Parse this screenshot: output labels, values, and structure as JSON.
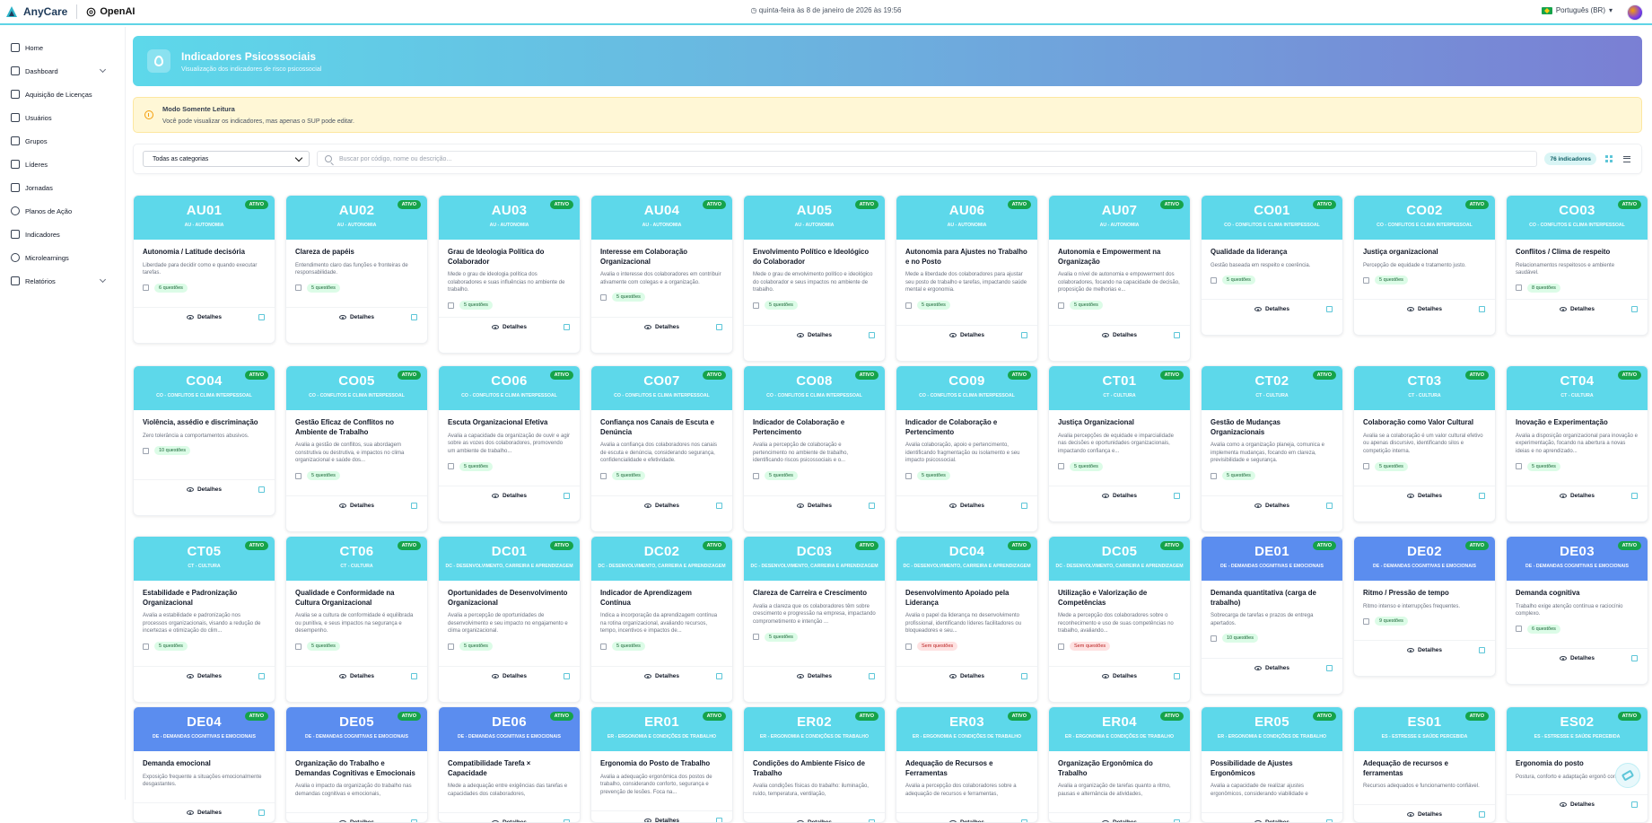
{
  "header": {
    "brand": "AnyCare",
    "partner": "OpenAI",
    "datetime": "quinta-feira às 8 de janeiro de 2026 às 19:56",
    "language": "Português (BR)"
  },
  "sidebar": {
    "items": [
      {
        "label": "Home",
        "icon": "home-icon"
      },
      {
        "label": "Dashboard",
        "icon": "dashboard-icon",
        "expandable": true
      },
      {
        "label": "Aquisição de Licenças",
        "icon": "license-icon"
      },
      {
        "label": "Usuários",
        "icon": "users-icon"
      },
      {
        "label": "Grupos",
        "icon": "folder-icon"
      },
      {
        "label": "Líderes",
        "icon": "leaders-icon"
      },
      {
        "label": "Jornadas",
        "icon": "journey-icon"
      },
      {
        "label": "Planos de Ação",
        "icon": "check-circle-icon"
      },
      {
        "label": "Indicadores",
        "icon": "indicators-icon"
      },
      {
        "label": "Microlearnings",
        "icon": "play-icon"
      },
      {
        "label": "Relatórios",
        "icon": "reports-icon",
        "expandable": true
      }
    ]
  },
  "hero": {
    "title": "Indicadores Psicossociais",
    "subtitle": "Visualização dos indicadores de risco psicossocial"
  },
  "notice": {
    "title": "Modo Somente Leitura",
    "text": "Você pode visualizar os indicadores, mas apenas o SUP pode editar."
  },
  "filters": {
    "category": "Todas as categorias",
    "search_placeholder": "Buscar por código, nome ou descrição...",
    "count": "76 indicadores"
  },
  "colors": {
    "cyan": "#5dd8ea",
    "blue": "#5b8def",
    "green": "#16a34a"
  },
  "card_labels": {
    "status": "ATIVO",
    "details": "Detalhes"
  },
  "cards": [
    {
      "code": "AU01",
      "cat": "AU - AUTONOMIA",
      "title": "Autonomia / Latitude decisória",
      "desc": "Liberdade para decidir como e quando executar tarefas.",
      "q": "6 questões"
    },
    {
      "code": "AU02",
      "cat": "AU - AUTONOMIA",
      "title": "Clareza de papéis",
      "desc": "Entendimento claro das funções e fronteiras de responsabilidade.",
      "q": "5 questões"
    },
    {
      "code": "AU03",
      "cat": "AU - AUTONOMIA",
      "title": "Grau de Ideologia Política do Colaborador",
      "desc": "Mede o grau de ideologia política dos colaboradores e suas influências no ambiente de trabalho.",
      "q": "5 questões"
    },
    {
      "code": "AU04",
      "cat": "AU - AUTONOMIA",
      "title": "Interesse em Colaboração Organizacional",
      "desc": "Avalia o interesse dos colaboradores em contribuir ativamente com colegas e a organização.",
      "q": "5 questões"
    },
    {
      "code": "AU05",
      "cat": "AU - AUTONOMIA",
      "title": "Envolvimento Político e Ideológico do Colaborador",
      "desc": "Mede o grau de envolvimento político e ideológico do colaborador e seus impactos no ambiente de trabalho.",
      "q": "5 questões"
    },
    {
      "code": "AU06",
      "cat": "AU - AUTONOMIA",
      "title": "Autonomia para Ajustes no Trabalho e no Posto",
      "desc": "Mede a liberdade dos colaboradores para ajustar seu posto de trabalho e tarefas, impactando saúde mental e ergonomia.",
      "q": "5 questões"
    },
    {
      "code": "AU07",
      "cat": "AU - AUTONOMIA",
      "title": "Autonomia e Empowerment na Organização",
      "desc": "Avalia o nível de autonomia e empowerment dos colaboradores, focando na capacidade de decisão, proposição de melhorias e...",
      "q": "5 questões"
    },
    {
      "code": "CO01",
      "cat": "CO - CONFLITOS E CLIMA INTERPESSOAL",
      "title": "Qualidade da liderança",
      "desc": "Gestão baseada em respeito e coerência.",
      "q": "5 questões"
    },
    {
      "code": "CO02",
      "cat": "CO - CONFLITOS E CLIMA INTERPESSOAL",
      "title": "Justiça organizacional",
      "desc": "Percepção de equidade e tratamento justo.",
      "q": "5 questões"
    },
    {
      "code": "CO03",
      "cat": "CO - CONFLITOS E CLIMA INTERPESSOAL",
      "title": "Conflitos / Clima de respeito",
      "desc": "Relacionamentos respeitosos e ambiente saudável.",
      "q": "8 questões"
    },
    {
      "code": "CO04",
      "cat": "CO - CONFLITOS E CLIMA INTERPESSOAL",
      "title": "Violência, assédio e discriminação",
      "desc": "Zero tolerância a comportamentos abusivos.",
      "q": "10 questões"
    },
    {
      "code": "CO05",
      "cat": "CO - CONFLITOS E CLIMA INTERPESSOAL",
      "title": "Gestão Eficaz de Conflitos no Ambiente de Trabalho",
      "desc": "Avalia a gestão de conflitos, sua abordagem construtiva ou destrutiva, e impactos no clima organizacional e saúde dos...",
      "q": "5 questões"
    },
    {
      "code": "CO06",
      "cat": "CO - CONFLITOS E CLIMA INTERPESSOAL",
      "title": "Escuta Organizacional Efetiva",
      "desc": "Avalia a capacidade da organização de ouvir e agir sobre as vozes dos colaboradores, promovendo um ambiente de trabalho...",
      "q": "5 questões"
    },
    {
      "code": "CO07",
      "cat": "CO - CONFLITOS E CLIMA INTERPESSOAL",
      "title": "Confiança nos Canais de Escuta e Denúncia",
      "desc": "Avalia a confiança dos colaboradores nos canais de escuta e denúncia, considerando segurança, confidencialidade e efetividade.",
      "q": "5 questões"
    },
    {
      "code": "CO08",
      "cat": "CO - CONFLITOS E CLIMA INTERPESSOAL",
      "title": "Indicador de Colaboração e Pertencimento",
      "desc": "Avalia a percepção de colaboração e pertencimento no ambiente de trabalho, identificando riscos psicossociais e o...",
      "q": "5 questões"
    },
    {
      "code": "CO09",
      "cat": "CO - CONFLITOS E CLIMA INTERPESSOAL",
      "title": "Indicador de Colaboração e Pertencimento",
      "desc": "Avalia colaboração, apoio e pertencimento, identificando fragmentação ou isolamento e seu impacto psicossocial.",
      "q": "5 questões"
    },
    {
      "code": "CT01",
      "cat": "CT - CULTURA",
      "title": "Justiça Organizacional",
      "desc": "Avalia percepções de equidade e imparcialidade nas decisões e oportunidades organizacionais, impactando confiança e...",
      "q": "5 questões"
    },
    {
      "code": "CT02",
      "cat": "CT - CULTURA",
      "title": "Gestão de Mudanças Organizacionais",
      "desc": "Avalia como a organização planeja, comunica e implementa mudanças, focando em clareza, previsibilidade e segurança.",
      "q": "5 questões"
    },
    {
      "code": "CT03",
      "cat": "CT - CULTURA",
      "title": "Colaboração como Valor Cultural",
      "desc": "Avalia se a colaboração é um valor cultural efetivo ou apenas discursivo, identificando silos e competição interna.",
      "q": "5 questões"
    },
    {
      "code": "CT04",
      "cat": "CT - CULTURA",
      "title": "Inovação e Experimentação",
      "desc": "Avalia a disposição organizacional para inovação e experimentação, focando na abertura a novas ideias e no aprendizado...",
      "q": "5 questões"
    },
    {
      "code": "CT05",
      "cat": "CT - CULTURA",
      "title": "Estabilidade e Padronização Organizacional",
      "desc": "Avalia a estabilidade e padronização nos processos organizacionais, visando a redução de incertezas e otimização do clim...",
      "q": "5 questões"
    },
    {
      "code": "CT06",
      "cat": "CT - CULTURA",
      "title": "Qualidade e Conformidade na Cultura Organizacional",
      "desc": "Avalia se a cultura de conformidade é equilibrada ou punitiva, e seus impactos na segurança e desempenho.",
      "q": "5 questões"
    },
    {
      "code": "DC01",
      "cat": "DC - DESENVOLVIMENTO, CARREIRA E APRENDIZAGEM",
      "title": "Oportunidades de Desenvolvimento Organizacional",
      "desc": "Avalia a percepção de oportunidades de desenvolvimento e seu impacto no engajamento e clima organizacional.",
      "q": "5 questões"
    },
    {
      "code": "DC02",
      "cat": "DC - DESENVOLVIMENTO, CARREIRA E APRENDIZAGEM",
      "title": "Indicador de Aprendizagem Contínua",
      "desc": "Indica a incorporação da aprendizagem contínua na rotina organizacional, avaliando recursos, tempo, incentivos e impactos de...",
      "q": "5 questões"
    },
    {
      "code": "DC03",
      "cat": "DC - DESENVOLVIMENTO, CARREIRA E APRENDIZAGEM",
      "title": "Clareza de Carreira e Crescimento",
      "desc": "Avalia a clareza que os colaboradores têm sobre crescimento e progressão na empresa, impactando comprometimento e intenção ...",
      "q": "5 questões"
    },
    {
      "code": "DC04",
      "cat": "DC - DESENVOLVIMENTO, CARREIRA E APRENDIZAGEM",
      "title": "Desenvolvimento Apoiado pela Liderança",
      "desc": "Avalia o papel da liderança no desenvolvimento profissional, identificando líderes facilitadores ou bloqueadores e seu...",
      "q": "Sem questões",
      "none": true
    },
    {
      "code": "DC05",
      "cat": "DC - DESENVOLVIMENTO, CARREIRA E APRENDIZAGEM",
      "title": "Utilização e Valorização de Competências",
      "desc": "Mede a percepção dos colaboradores sobre o reconhecimento e uso de suas competências no trabalho, avaliando...",
      "q": "Sem questões",
      "none": true
    },
    {
      "code": "DE01",
      "cat": "DE - DEMANDAS COGNITIVAS E EMOCIONAIS",
      "title": "Demanda quantitativa (carga de trabalho)",
      "desc": "Sobrecarga de tarefas e prazos de entrega apertados.",
      "q": "10 questões",
      "blue": true
    },
    {
      "code": "DE02",
      "cat": "DE - DEMANDAS COGNITIVAS E EMOCIONAIS",
      "title": "Ritmo / Pressão de tempo",
      "desc": "Ritmo intenso e interrupções frequentes.",
      "q": "9 questões",
      "blue": true
    },
    {
      "code": "DE03",
      "cat": "DE - DEMANDAS COGNITIVAS E EMOCIONAIS",
      "title": "Demanda cognitiva",
      "desc": "Trabalho exige atenção contínua e raciocínio complexo.",
      "q": "6 questões",
      "blue": true
    },
    {
      "code": "DE04",
      "cat": "DE - DEMANDAS COGNITIVAS E EMOCIONAIS",
      "title": "Demanda emocional",
      "desc": "Exposição frequente a situações emocionalmente desgastantes.",
      "q": "",
      "blue": true
    },
    {
      "code": "DE05",
      "cat": "DE - DEMANDAS COGNITIVAS E EMOCIONAIS",
      "title": "Organização do Trabalho e Demandas Cognitivas e Emocionais",
      "desc": "Avalia o impacto da organização do trabalho nas demandas cognitivas e emocionais,",
      "q": "",
      "blue": true
    },
    {
      "code": "DE06",
      "cat": "DE - DEMANDAS COGNITIVAS E EMOCIONAIS",
      "title": "Compatibilidade Tarefa × Capacidade",
      "desc": "Mede a adequação entre exigências das tarefas e capacidades dos colaboradores,",
      "q": "",
      "blue": true
    },
    {
      "code": "ER01",
      "cat": "ER - ERGONOMIA E CONDIÇÕES DE TRABALHO",
      "title": "Ergonomia do Posto de Trabalho",
      "desc": "Avalia a adequação ergonômica dos postos de trabalho, considerando conforto, segurança e prevenção de lesões. Foca na...",
      "q": ""
    },
    {
      "code": "ER02",
      "cat": "ER - ERGONOMIA E CONDIÇÕES DE TRABALHO",
      "title": "Condições do Ambiente Físico de Trabalho",
      "desc": "Avalia condições físicas do trabalho: iluminação, ruído, temperatura, ventilação,",
      "q": ""
    },
    {
      "code": "ER03",
      "cat": "ER - ERGONOMIA E CONDIÇÕES DE TRABALHO",
      "title": "Adequação de Recursos e Ferramentas",
      "desc": "Avalia a percepção dos colaboradores sobre a adequação de recursos e ferramentas,",
      "q": ""
    },
    {
      "code": "ER04",
      "cat": "ER - ERGONOMIA E CONDIÇÕES DE TRABALHO",
      "title": "Organização Ergonômica do Trabalho",
      "desc": "Avalia a organização de tarefas quanto a ritmo, pausas e alternância de atividades,",
      "q": ""
    },
    {
      "code": "ER05",
      "cat": "ER - ERGONOMIA E CONDIÇÕES DE TRABALHO",
      "title": "Possibilidade de Ajustes Ergonômicos",
      "desc": "Avalia a capacidade de realizar ajustes ergonômicos, considerando viabilidade e",
      "q": ""
    },
    {
      "code": "ES01",
      "cat": "ES - ESTRESSE E SAÚDE PERCEBIDA",
      "title": "Adequação de recursos e ferramentas",
      "desc": "Recursos adequados e funcionamento confiável.",
      "q": ""
    },
    {
      "code": "ES02",
      "cat": "ES - ESTRESSE E SAÚDE PERCEBIDA",
      "title": "Ergonomia do posto",
      "desc": "Postura, conforto e adaptação ergonô corretas.",
      "q": ""
    }
  ]
}
